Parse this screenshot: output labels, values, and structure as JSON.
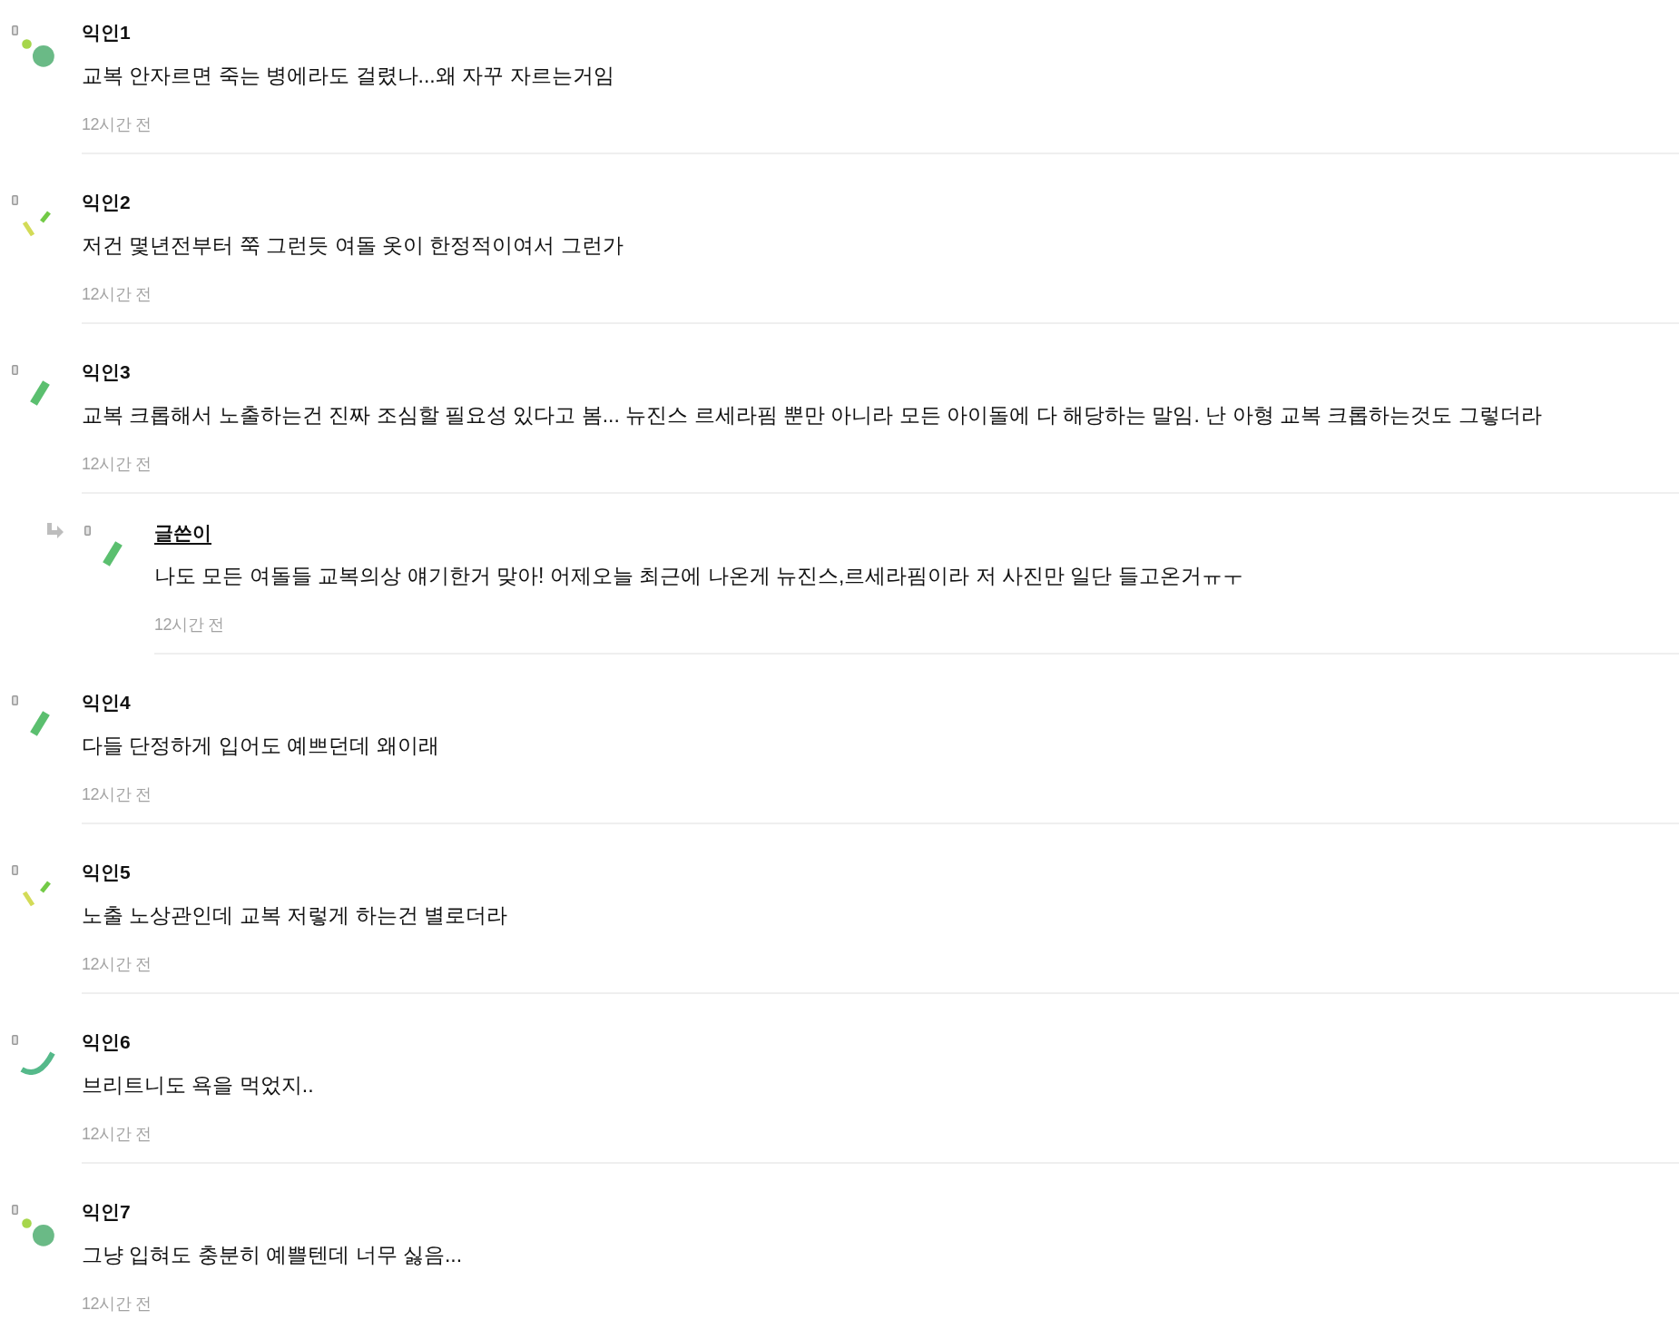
{
  "comments": [
    {
      "author": "익인1",
      "writer": false,
      "reply": false,
      "kind": "dots",
      "text": "교복 안자르면 죽는 병에라도 걸렸나...왜 자꾸 자르는거임",
      "time": "12시간 전"
    },
    {
      "author": "익인2",
      "writer": false,
      "reply": false,
      "kind": "dashes",
      "text": "저건 몇년전부터 쭉 그런듯 여돌 옷이 한정적이여서 그런가",
      "time": "12시간 전"
    },
    {
      "author": "익인3",
      "writer": false,
      "reply": false,
      "kind": "bar",
      "text": "교복 크롭해서 노출하는건 진짜 조심할 필요성 있다고 봄... 뉴진스 르세라핌 뿐만 아니라 모든 아이돌에 다 해당하는 말임. 난 아형 교복 크롭하는것도 그렇더라",
      "time": "12시간 전"
    },
    {
      "author": "글쓴이",
      "writer": true,
      "reply": true,
      "kind": "bar",
      "text": "나도 모든 여돌들 교복의상 얘기한거 맞아! 어제오늘 최근에 나온게 뉴진스,르세라핌이라 저 사진만 일단 들고온거ㅠㅜ",
      "time": "12시간 전"
    },
    {
      "author": "익인4",
      "writer": false,
      "reply": false,
      "kind": "bar",
      "text": "다들 단정하게 입어도 예쁘던데 왜이래",
      "time": "12시간 전"
    },
    {
      "author": "익인5",
      "writer": false,
      "reply": false,
      "kind": "dashes",
      "text": "노출 노상관인데 교복 저렇게 하는건 별로더라",
      "time": "12시간 전"
    },
    {
      "author": "익인6",
      "writer": false,
      "reply": false,
      "kind": "arc",
      "text": "브리트니도 욕을 먹었지..",
      "time": "12시간 전"
    },
    {
      "author": "익인7",
      "writer": false,
      "reply": false,
      "kind": "dots",
      "text": "그냥 입혀도 충분히 예쁠텐데 너무 싫음...",
      "time": "12시간 전"
    }
  ]
}
